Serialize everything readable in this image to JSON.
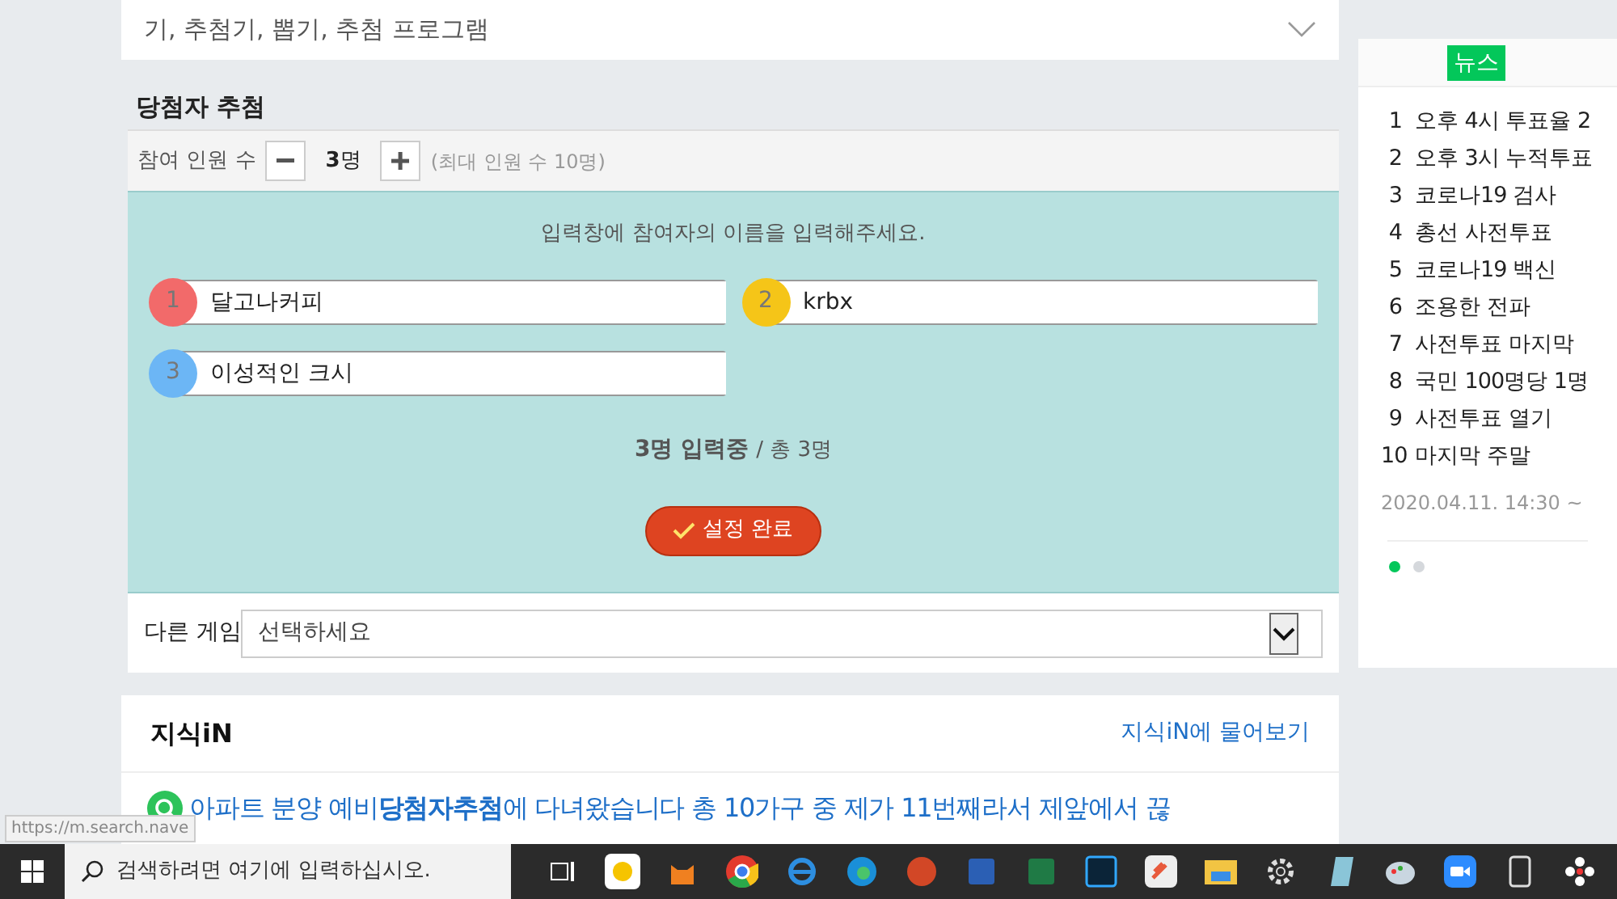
{
  "search_box": {
    "text": "기, 추첨기, 뽑기, 추첨 프로그램"
  },
  "draw": {
    "title": "당첨자 추첨",
    "count_label": "참여 인원 수",
    "count": "3",
    "count_unit": "명",
    "max_note": "(최대 인원 수 10명)",
    "instruction": "입력창에 참여자의 이름을 입력해주세요.",
    "entries": [
      {
        "number": "1",
        "value": "달고나커피",
        "color": "#f26a6a"
      },
      {
        "number": "2",
        "value": "krbx",
        "color": "#f5c518"
      },
      {
        "number": "3",
        "value": "이성적인 크시",
        "color": "#6cb6f5"
      }
    ],
    "status_bold": "3명 입력중",
    "status_rest": "/ 총 3명",
    "submit": "설정 완료",
    "other_game_label": "다른 게임",
    "other_game_value": "선택하세요"
  },
  "knowledge": {
    "title": "지식iN",
    "ask_link": "지식iN에 물어보기",
    "result": "아파트 분양 예비**당첨자추첨**에 다녀왔습니다 총 10가구 중 제가 11번째라서 제앞에서 끊"
  },
  "news": {
    "tab": "뉴스",
    "items": [
      {
        "rank": "1",
        "title": "오후 4시 투표율 2"
      },
      {
        "rank": "2",
        "title": "오후 3시 누적투표"
      },
      {
        "rank": "3",
        "title": "코로나19 검사"
      },
      {
        "rank": "4",
        "title": "총선 사전투표"
      },
      {
        "rank": "5",
        "title": "코로나19 백신"
      },
      {
        "rank": "6",
        "title": "조용한 전파"
      },
      {
        "rank": "7",
        "title": "사전투표 마지막"
      },
      {
        "rank": "8",
        "title": "국민 100명당 1명"
      },
      {
        "rank": "9",
        "title": "사전투표 열기"
      },
      {
        "rank": "10",
        "title": "마지막 주말"
      }
    ],
    "timestamp": "2020.04.11. 14:30 ~",
    "pages": [
      {
        "selected": true
      },
      {
        "selected": false
      }
    ]
  },
  "status_url": "https://m.search.nave",
  "taskbar": {
    "search_placeholder": "검색하려면 여기에 입력하십시오."
  }
}
